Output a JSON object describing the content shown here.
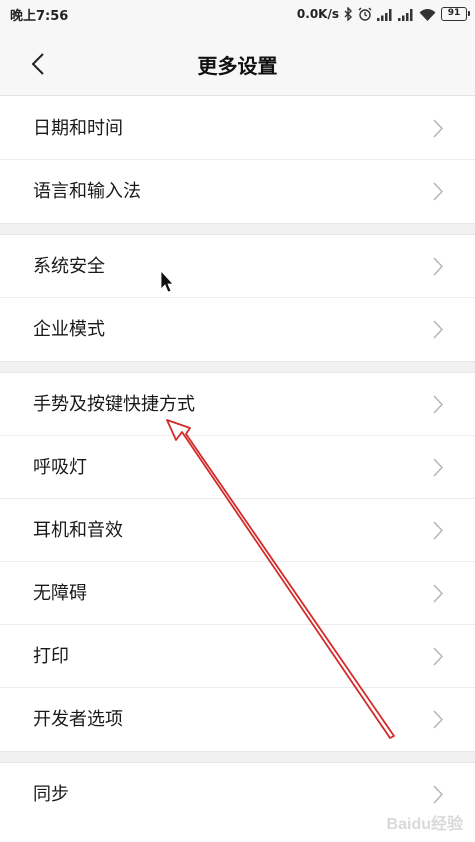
{
  "status_bar": {
    "time": "晚上7:56",
    "net_speed": "0.0K/s",
    "battery": "91",
    "icons": [
      "bluetooth-icon",
      "alarm-icon",
      "signal-icon",
      "signal-icon",
      "wifi-icon",
      "battery-icon"
    ]
  },
  "header": {
    "back_icon": "chevron-left-icon",
    "title": "更多设置"
  },
  "groups": [
    {
      "items": [
        {
          "label": "日期和时间"
        },
        {
          "label": "语言和输入法"
        }
      ]
    },
    {
      "items": [
        {
          "label": "系统安全"
        },
        {
          "label": "企业模式"
        }
      ]
    },
    {
      "items": [
        {
          "label": "手势及按键快捷方式"
        },
        {
          "label": "呼吸灯"
        },
        {
          "label": "耳机和音效"
        },
        {
          "label": "无障碍"
        },
        {
          "label": "打印"
        },
        {
          "label": "开发者选项"
        }
      ]
    },
    {
      "items": [
        {
          "label": "同步"
        }
      ]
    }
  ],
  "annotation": {
    "arrow_color": "#d42a2a",
    "cursor_icon": "mouse-pointer-icon"
  },
  "watermark": "Baidu经验"
}
